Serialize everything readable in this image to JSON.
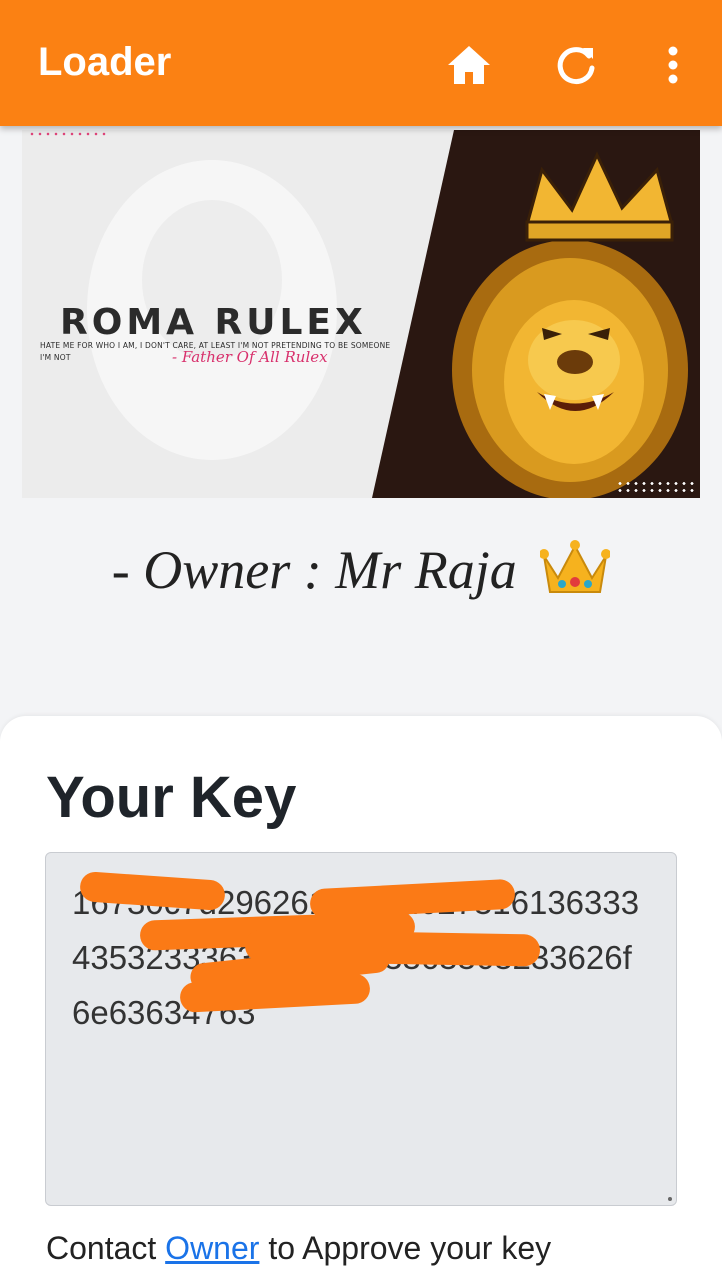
{
  "appbar": {
    "title": "Loader",
    "icons": [
      "home-icon",
      "refresh-icon",
      "more-vert-icon"
    ],
    "color": "#fb8113"
  },
  "banner": {
    "brand": "ROMA RULEX",
    "tagline": "HATE ME FOR WHO I AM, I DON'T CARE, AT LEAST I'M NOT PRETENDING TO BE SOMEONE I'M NOT",
    "signature": "- Father Of All Rulex"
  },
  "owner": {
    "text": "- Owner : Mr Raja",
    "emoji": "crown-icon"
  },
  "key_card": {
    "heading": "Your Key",
    "key_value": "16730c7d2962616516d627316136333435323336333363363363363233626f6e63634763",
    "contact_prefix": "Contact ",
    "contact_link": "Owner",
    "contact_suffix": " to Approve your key"
  }
}
